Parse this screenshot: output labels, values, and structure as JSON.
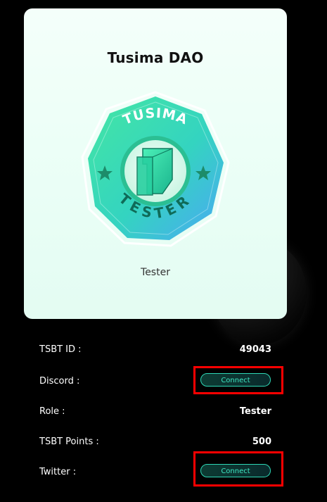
{
  "card": {
    "title": "Tusima DAO",
    "subtitle": "Tester",
    "badge": {
      "top_text": "TUSIMA",
      "bottom_text": "TESTER",
      "star_icon": "star-icon",
      "logo_icon": "cube-logo-icon"
    }
  },
  "details": {
    "tsbt_id": {
      "label": "TSBT ID :",
      "value": "49043"
    },
    "discord": {
      "label": "Discord :",
      "button": "Connect"
    },
    "role": {
      "label": "Role :",
      "value": "Tester"
    },
    "points": {
      "label": "TSBT Points :",
      "value": "500"
    },
    "twitter": {
      "label": "Twitter :",
      "button": "Connect"
    }
  },
  "colors": {
    "page_bg": "#000000",
    "card_bg": "#ecfff7",
    "accent": "#2ed8b6",
    "highlight": "#ff0000"
  }
}
